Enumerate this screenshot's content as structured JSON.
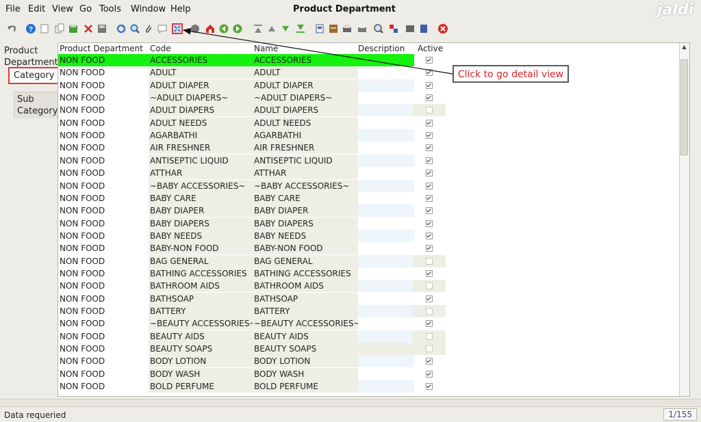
{
  "menu": [
    {
      "label": "File"
    },
    {
      "label": "Edit"
    },
    {
      "label": "View"
    },
    {
      "label": "Go"
    },
    {
      "label": "Tools"
    },
    {
      "label": "Window"
    },
    {
      "label": "Help"
    }
  ],
  "window_title": "Product Department",
  "logo_text": "jaldi",
  "toolbar_icons": [
    "undo",
    "help",
    "new",
    "copy",
    "save-green",
    "delete",
    "save",
    "refresh",
    "find",
    "attach",
    "chat",
    "detail-view",
    "grid",
    "home",
    "back",
    "forward",
    "first",
    "previous",
    "next",
    "last",
    "report",
    "archive",
    "print",
    "print-preview",
    "zoom",
    "translate",
    "process",
    "exit",
    "close"
  ],
  "tabs": {
    "product_department": "Product\nDepartment",
    "category": "Category",
    "sub_category": "Sub\nCategory"
  },
  "columns": {
    "dept": "Product Department",
    "code": "Code",
    "name": "Name",
    "desc": "Description",
    "active": "Active"
  },
  "rows": [
    {
      "dept": "NON FOOD",
      "code": "ACCESSORIES",
      "name": "ACCESSORIES",
      "desc": "",
      "active": true
    },
    {
      "dept": "NON FOOD",
      "code": "ADULT",
      "name": "ADULT",
      "desc": "",
      "active": true
    },
    {
      "dept": "NON FOOD",
      "code": "ADULT DIAPER",
      "name": "ADULT DIAPER",
      "desc": "",
      "active": true
    },
    {
      "dept": "NON FOOD",
      "code": "~ADULT DIAPERS~",
      "name": "~ADULT DIAPERS~",
      "desc": "",
      "active": true
    },
    {
      "dept": "NON FOOD",
      "code": "ADULT DIAPERS",
      "name": "ADULT DIAPERS",
      "desc": "",
      "active": false
    },
    {
      "dept": "NON FOOD",
      "code": "ADULT NEEDS",
      "name": "ADULT NEEDS",
      "desc": "",
      "active": true
    },
    {
      "dept": "NON FOOD",
      "code": "AGARBATHI",
      "name": "AGARBATHI",
      "desc": "",
      "active": true
    },
    {
      "dept": "NON FOOD",
      "code": "AIR FRESHNER",
      "name": "AIR FRESHNER",
      "desc": "",
      "active": true
    },
    {
      "dept": "NON FOOD",
      "code": "ANTISEPTIC LIQUID",
      "name": "ANTISEPTIC LIQUID",
      "desc": "",
      "active": true
    },
    {
      "dept": "NON FOOD",
      "code": "ATTHAR",
      "name": "ATTHAR",
      "desc": "",
      "active": true
    },
    {
      "dept": "NON FOOD",
      "code": "~BABY ACCESSORIES~",
      "name": "~BABY ACCESSORIES~",
      "desc": "",
      "active": true
    },
    {
      "dept": "NON FOOD",
      "code": "BABY CARE",
      "name": "BABY CARE",
      "desc": "",
      "active": true
    },
    {
      "dept": "NON FOOD",
      "code": "BABY DIAPER",
      "name": "BABY DIAPER",
      "desc": "",
      "active": true
    },
    {
      "dept": "NON FOOD",
      "code": "BABY DIAPERS",
      "name": "BABY DIAPERS",
      "desc": "",
      "active": true
    },
    {
      "dept": "NON FOOD",
      "code": "BABY NEEDS",
      "name": "BABY NEEDS",
      "desc": "",
      "active": true
    },
    {
      "dept": "NON FOOD",
      "code": "BABY-NON FOOD",
      "name": "BABY-NON FOOD",
      "desc": "",
      "active": true
    },
    {
      "dept": "NON FOOD",
      "code": "BAG GENERAL",
      "name": "BAG GENERAL",
      "desc": "",
      "active": false
    },
    {
      "dept": "NON FOOD",
      "code": "BATHING ACCESSORIES",
      "name": "BATHING ACCESSORIES",
      "desc": "",
      "active": true
    },
    {
      "dept": "NON FOOD",
      "code": "BATHROOM AIDS",
      "name": "BATHROOM AIDS",
      "desc": "",
      "active": false
    },
    {
      "dept": "NON FOOD",
      "code": "BATHSOAP",
      "name": "BATHSOAP",
      "desc": "",
      "active": true
    },
    {
      "dept": "NON FOOD",
      "code": "BATTERY",
      "name": "BATTERY",
      "desc": "",
      "active": false
    },
    {
      "dept": "NON FOOD",
      "code": "~BEAUTY ACCESSORIES~",
      "name": "~BEAUTY ACCESSORIES~",
      "desc": "",
      "active": true
    },
    {
      "dept": "NON FOOD",
      "code": "BEAUTY AIDS",
      "name": "BEAUTY AIDS",
      "desc": "",
      "active": false
    },
    {
      "dept": "NON FOOD",
      "code": "BEAUTY SOAPS",
      "name": "BEAUTY SOAPS",
      "desc": "",
      "active": false
    },
    {
      "dept": "NON FOOD",
      "code": "BODY LOTION",
      "name": "BODY LOTION",
      "desc": "",
      "active": true
    },
    {
      "dept": "NON FOOD",
      "code": "BODY WASH",
      "name": "BODY WASH",
      "desc": "",
      "active": true
    },
    {
      "dept": "NON FOOD",
      "code": "BOLD PERFUME",
      "name": "BOLD PERFUME",
      "desc": "",
      "active": true
    }
  ],
  "callout_text": "Click to go detail view",
  "status": {
    "text": "Data requeried",
    "record_count": "1/155"
  },
  "colors": {
    "selected_row": "#15f20f",
    "alt_col": "#efeee4",
    "desc_col": "#eef5fb",
    "highlight": "#e0383a"
  }
}
